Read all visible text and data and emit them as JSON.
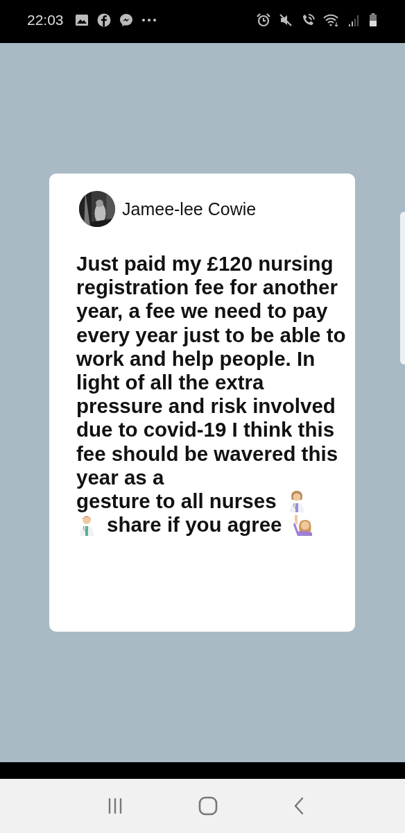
{
  "status_bar": {
    "time": "22:03"
  },
  "post": {
    "author": "Jamee-lee Cowie",
    "text": "Just paid my £120 nursing registration fee for another year, a fee we need to pay every year just to be able to work and help people. In light of all the extra pressure and risk involved due to covid-19 I think this fee should be wavered this year as a",
    "text_line": "gesture to all nurses",
    "text_end": "share if you agree"
  }
}
